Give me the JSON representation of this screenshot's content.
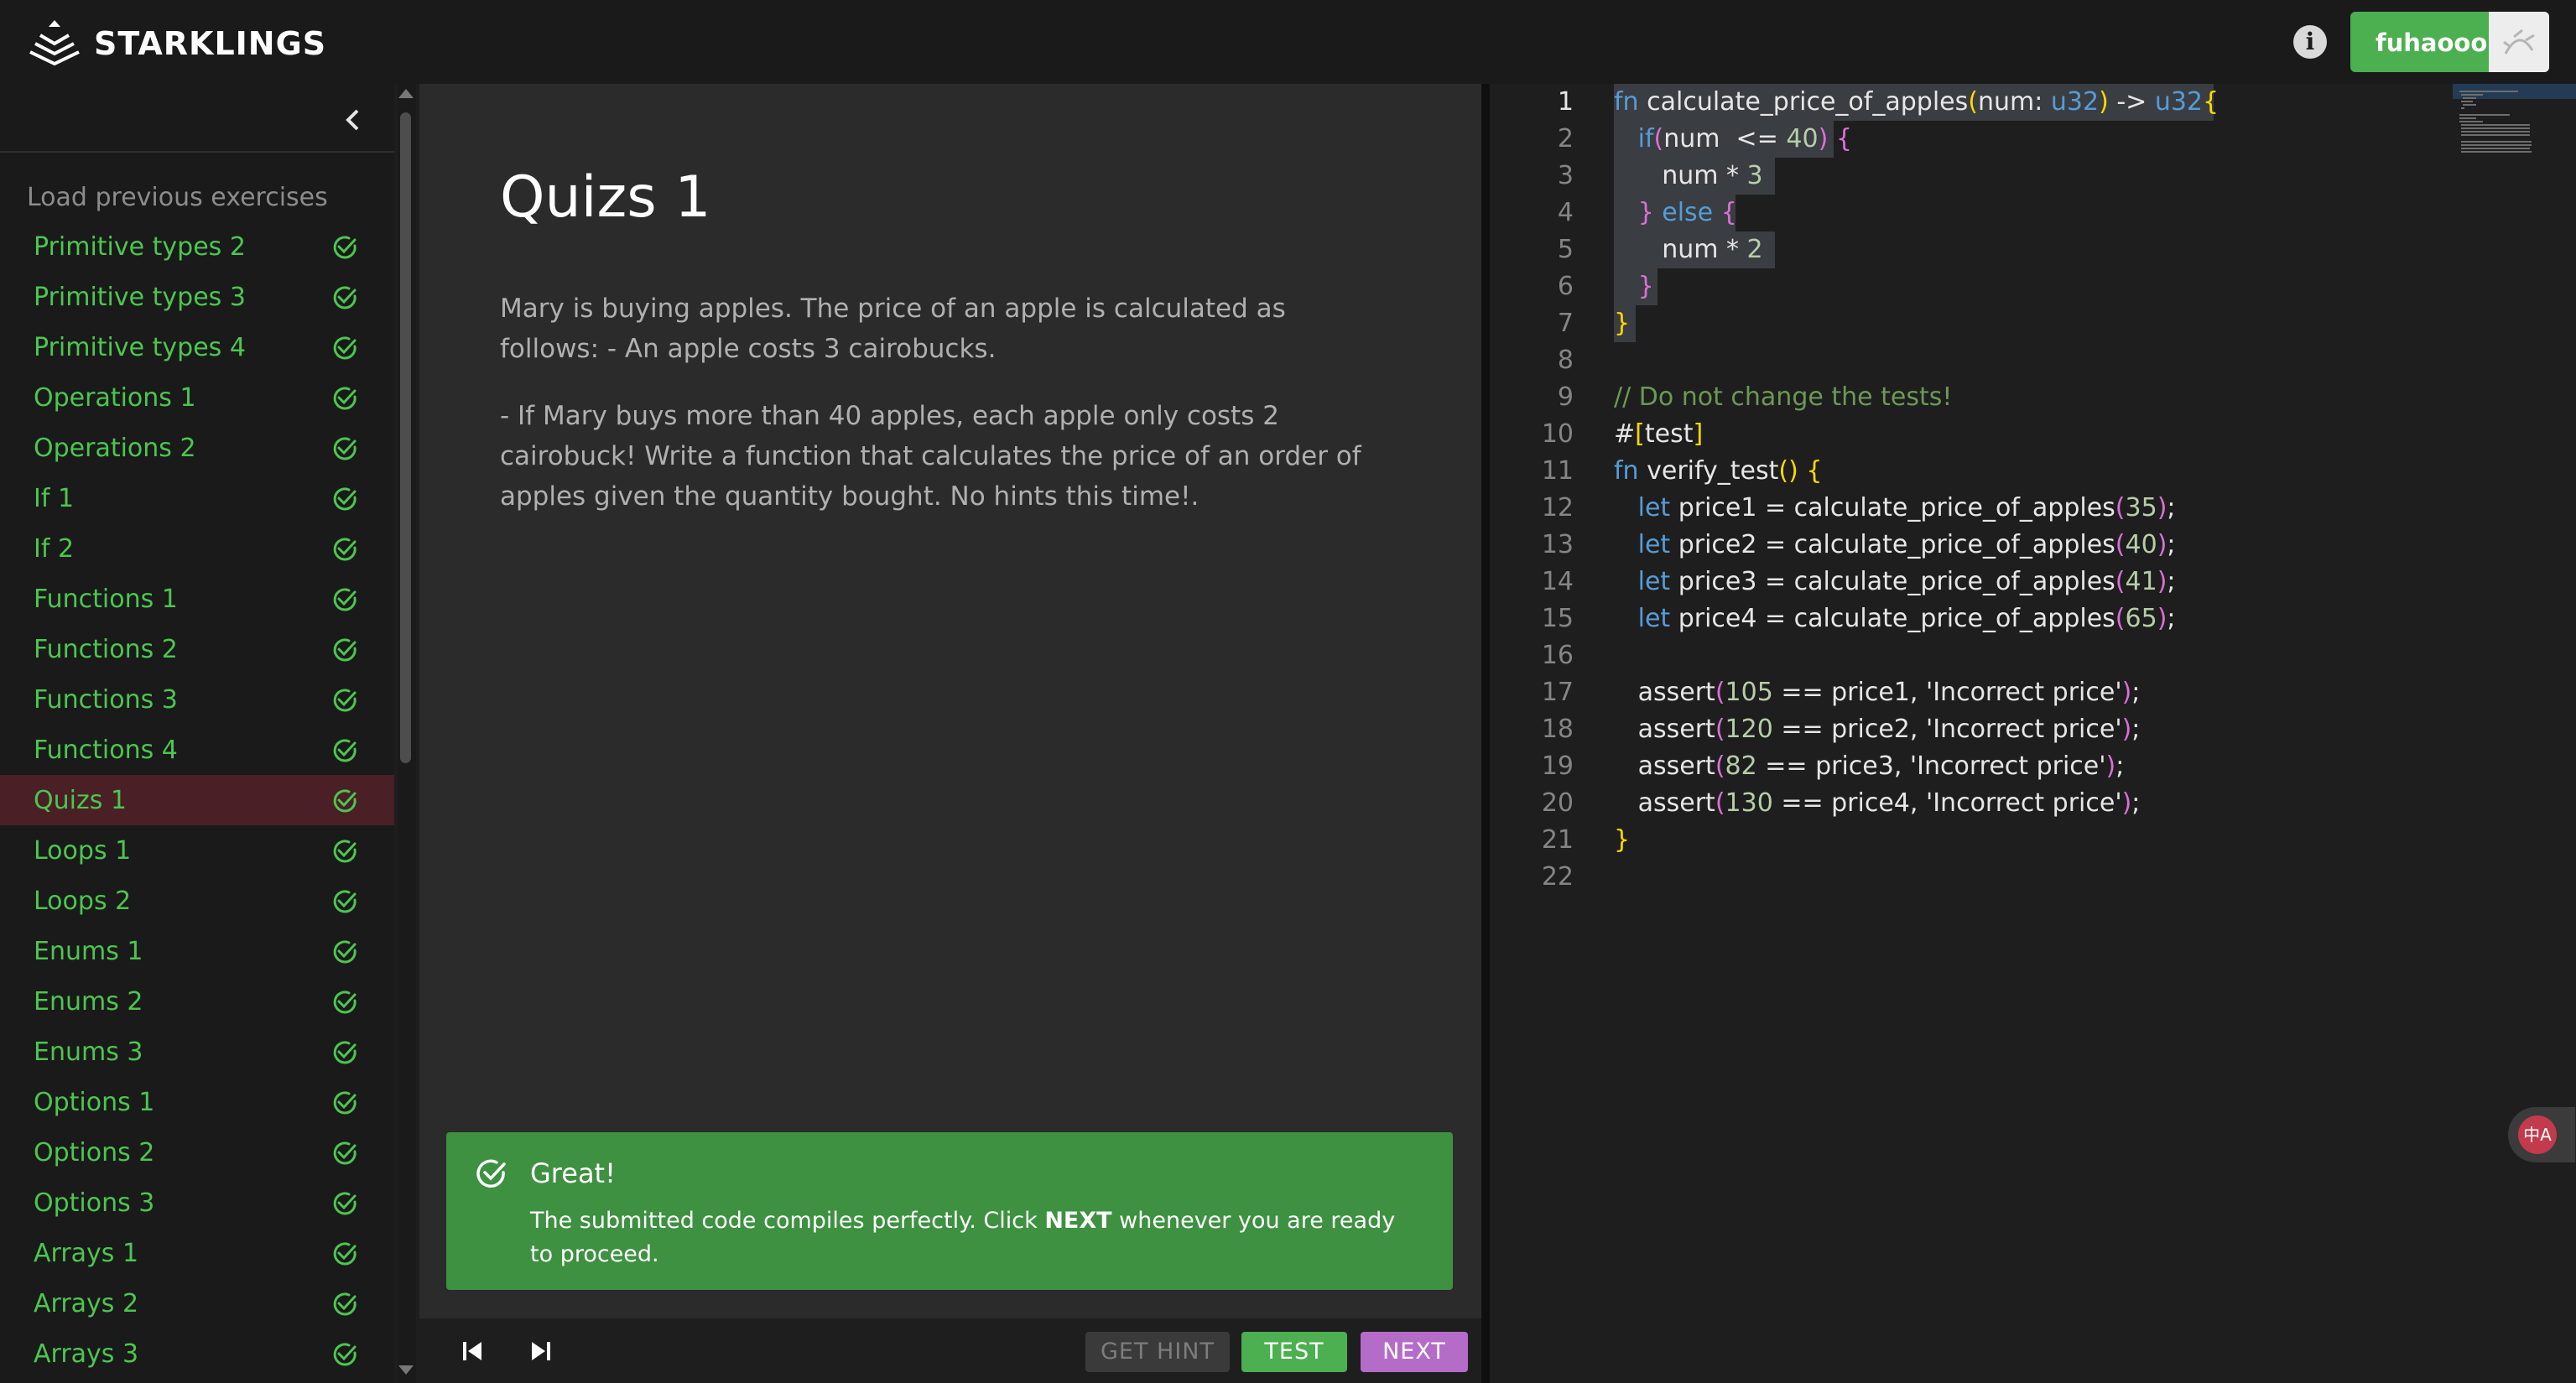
{
  "app": {
    "brand": "STARKLINGS",
    "user": "fuhaooo",
    "info_icon": "info-icon",
    "accent_green": "#4caf50",
    "accent_purple": "#b56cc9"
  },
  "sidebar": {
    "load_previous": "Load previous exercises",
    "items": [
      {
        "label": "Primitive types 2",
        "status": "done"
      },
      {
        "label": "Primitive types 3",
        "status": "done"
      },
      {
        "label": "Primitive types 4",
        "status": "done"
      },
      {
        "label": "Operations 1",
        "status": "done"
      },
      {
        "label": "Operations 2",
        "status": "done"
      },
      {
        "label": "If 1",
        "status": "done"
      },
      {
        "label": "If 2",
        "status": "done"
      },
      {
        "label": "Functions 1",
        "status": "done"
      },
      {
        "label": "Functions 2",
        "status": "done"
      },
      {
        "label": "Functions 3",
        "status": "done"
      },
      {
        "label": "Functions 4",
        "status": "done"
      },
      {
        "label": "Quizs 1",
        "status": "done",
        "active": true
      },
      {
        "label": "Loops 1",
        "status": "done"
      },
      {
        "label": "Loops 2",
        "status": "done"
      },
      {
        "label": "Enums 1",
        "status": "done"
      },
      {
        "label": "Enums 2",
        "status": "done"
      },
      {
        "label": "Enums 3",
        "status": "done"
      },
      {
        "label": "Options 1",
        "status": "done"
      },
      {
        "label": "Options 2",
        "status": "done"
      },
      {
        "label": "Options 3",
        "status": "done"
      },
      {
        "label": "Arrays 1",
        "status": "done"
      },
      {
        "label": "Arrays 2",
        "status": "done"
      },
      {
        "label": "Arrays 3",
        "status": "done"
      }
    ]
  },
  "exercise": {
    "title": "Quizs 1",
    "paragraph1": "Mary is buying apples. The price of an apple is calculated as follows: - An apple costs 3 cairobucks.",
    "paragraph2": "- If Mary buys more than 40 apples, each apple only costs 2 cairobuck! Write a function that calculates the price of an order of apples given the quantity bought. No hints this time!."
  },
  "result": {
    "title": "Great!",
    "msg_before": "The submitted code compiles perfectly. Click ",
    "msg_bold": "NEXT",
    "msg_after": " whenever you are ready to proceed."
  },
  "actions": {
    "hint": "GET HINT",
    "test": "TEST",
    "next": "NEXT"
  },
  "editor": {
    "line_numbers": [
      "1",
      "2",
      "3",
      "4",
      "5",
      "6",
      "7",
      "8",
      "9",
      "10",
      "11",
      "12",
      "13",
      "14",
      "15",
      "16",
      "17",
      "18",
      "19",
      "20",
      "21",
      "22"
    ],
    "current_line": 1,
    "translate_label": "中A"
  }
}
